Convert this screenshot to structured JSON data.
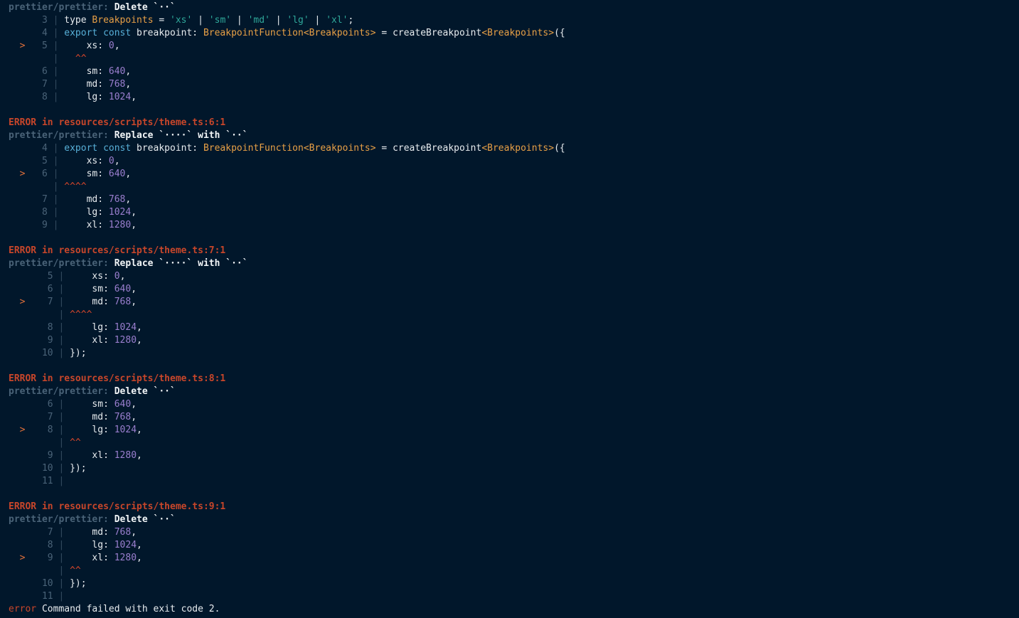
{
  "lines": [
    {
      "kind": "pp",
      "prefix": "prettier/prettier:",
      "msg": "Delete `··`"
    },
    {
      "kind": "code",
      "num": "3",
      "marked": false,
      "tokens": [
        {
          "c": "id",
          "t": "type "
        },
        {
          "c": "type",
          "t": "Breakpoints"
        },
        {
          "c": "id",
          "t": " = "
        },
        {
          "c": "str",
          "t": "'xs'"
        },
        {
          "c": "id",
          "t": " | "
        },
        {
          "c": "str",
          "t": "'sm'"
        },
        {
          "c": "id",
          "t": " | "
        },
        {
          "c": "str",
          "t": "'md'"
        },
        {
          "c": "id",
          "t": " | "
        },
        {
          "c": "str",
          "t": "'lg'"
        },
        {
          "c": "id",
          "t": " | "
        },
        {
          "c": "str",
          "t": "'xl'"
        },
        {
          "c": "id",
          "t": ";"
        }
      ]
    },
    {
      "kind": "code",
      "num": "4",
      "marked": false,
      "tokens": [
        {
          "c": "kw",
          "t": "export const "
        },
        {
          "c": "id",
          "t": "breakpoint: "
        },
        {
          "c": "type",
          "t": "BreakpointFunction<Breakpoints>"
        },
        {
          "c": "id",
          "t": " = createBreakpoint"
        },
        {
          "c": "type",
          "t": "<Breakpoints>"
        },
        {
          "c": "id",
          "t": "({"
        }
      ]
    },
    {
      "kind": "code",
      "num": "5",
      "marked": true,
      "tokens": [
        {
          "c": "id",
          "t": "    xs: "
        },
        {
          "c": "num",
          "t": "0"
        },
        {
          "c": "id",
          "t": ","
        }
      ]
    },
    {
      "kind": "caret",
      "caret": "  ^^"
    },
    {
      "kind": "code",
      "num": "6",
      "marked": false,
      "tokens": [
        {
          "c": "id",
          "t": "    sm: "
        },
        {
          "c": "num",
          "t": "640"
        },
        {
          "c": "id",
          "t": ","
        }
      ]
    },
    {
      "kind": "code",
      "num": "7",
      "marked": false,
      "tokens": [
        {
          "c": "id",
          "t": "    md: "
        },
        {
          "c": "num",
          "t": "768"
        },
        {
          "c": "id",
          "t": ","
        }
      ]
    },
    {
      "kind": "code",
      "num": "8",
      "marked": false,
      "tokens": [
        {
          "c": "id",
          "t": "    lg: "
        },
        {
          "c": "num",
          "t": "1024"
        },
        {
          "c": "id",
          "t": ","
        }
      ]
    },
    {
      "kind": "blank"
    },
    {
      "kind": "error",
      "label": "ERROR",
      "word": "in",
      "path": "resources/scripts/theme.ts:6:1"
    },
    {
      "kind": "pp",
      "prefix": "prettier/prettier:",
      "msg": "Replace `····` with `··`"
    },
    {
      "kind": "code",
      "num": "4",
      "marked": false,
      "tokens": [
        {
          "c": "kw",
          "t": "export const "
        },
        {
          "c": "id",
          "t": "breakpoint: "
        },
        {
          "c": "type",
          "t": "BreakpointFunction<Breakpoints>"
        },
        {
          "c": "id",
          "t": " = createBreakpoint"
        },
        {
          "c": "type",
          "t": "<Breakpoints>"
        },
        {
          "c": "id",
          "t": "({"
        }
      ]
    },
    {
      "kind": "code",
      "num": "5",
      "marked": false,
      "tokens": [
        {
          "c": "id",
          "t": "    xs: "
        },
        {
          "c": "num",
          "t": "0"
        },
        {
          "c": "id",
          "t": ","
        }
      ]
    },
    {
      "kind": "code",
      "num": "6",
      "marked": true,
      "tokens": [
        {
          "c": "id",
          "t": "    sm: "
        },
        {
          "c": "num",
          "t": "640"
        },
        {
          "c": "id",
          "t": ","
        }
      ]
    },
    {
      "kind": "caret",
      "caret": "^^^^"
    },
    {
      "kind": "code",
      "num": "7",
      "marked": false,
      "tokens": [
        {
          "c": "id",
          "t": "    md: "
        },
        {
          "c": "num",
          "t": "768"
        },
        {
          "c": "id",
          "t": ","
        }
      ]
    },
    {
      "kind": "code",
      "num": "8",
      "marked": false,
      "tokens": [
        {
          "c": "id",
          "t": "    lg: "
        },
        {
          "c": "num",
          "t": "1024"
        },
        {
          "c": "id",
          "t": ","
        }
      ]
    },
    {
      "kind": "code",
      "num": "9",
      "marked": false,
      "tokens": [
        {
          "c": "id",
          "t": "    xl: "
        },
        {
          "c": "num",
          "t": "1280"
        },
        {
          "c": "id",
          "t": ","
        }
      ]
    },
    {
      "kind": "blank"
    },
    {
      "kind": "error",
      "label": "ERROR",
      "word": "in",
      "path": "resources/scripts/theme.ts:7:1"
    },
    {
      "kind": "pp",
      "prefix": "prettier/prettier:",
      "msg": "Replace `····` with `··`"
    },
    {
      "kind": "code",
      "num": "5",
      "wide": true,
      "marked": false,
      "tokens": [
        {
          "c": "id",
          "t": "    xs: "
        },
        {
          "c": "num",
          "t": "0"
        },
        {
          "c": "id",
          "t": ","
        }
      ]
    },
    {
      "kind": "code",
      "num": "6",
      "wide": true,
      "marked": false,
      "tokens": [
        {
          "c": "id",
          "t": "    sm: "
        },
        {
          "c": "num",
          "t": "640"
        },
        {
          "c": "id",
          "t": ","
        }
      ]
    },
    {
      "kind": "code",
      "num": "7",
      "wide": true,
      "marked": true,
      "tokens": [
        {
          "c": "id",
          "t": "    md: "
        },
        {
          "c": "num",
          "t": "768"
        },
        {
          "c": "id",
          "t": ","
        }
      ]
    },
    {
      "kind": "caret",
      "wide": true,
      "caret": "^^^^"
    },
    {
      "kind": "code",
      "num": "8",
      "wide": true,
      "marked": false,
      "tokens": [
        {
          "c": "id",
          "t": "    lg: "
        },
        {
          "c": "num",
          "t": "1024"
        },
        {
          "c": "id",
          "t": ","
        }
      ]
    },
    {
      "kind": "code",
      "num": "9",
      "wide": true,
      "marked": false,
      "tokens": [
        {
          "c": "id",
          "t": "    xl: "
        },
        {
          "c": "num",
          "t": "1280"
        },
        {
          "c": "id",
          "t": ","
        }
      ]
    },
    {
      "kind": "code",
      "num": "10",
      "wide": true,
      "marked": false,
      "tokens": [
        {
          "c": "id",
          "t": "});"
        }
      ]
    },
    {
      "kind": "blank"
    },
    {
      "kind": "error",
      "label": "ERROR",
      "word": "in",
      "path": "resources/scripts/theme.ts:8:1"
    },
    {
      "kind": "pp",
      "prefix": "prettier/prettier:",
      "msg": "Delete `··`"
    },
    {
      "kind": "code",
      "num": "6",
      "wide": true,
      "marked": false,
      "tokens": [
        {
          "c": "id",
          "t": "    sm: "
        },
        {
          "c": "num",
          "t": "640"
        },
        {
          "c": "id",
          "t": ","
        }
      ]
    },
    {
      "kind": "code",
      "num": "7",
      "wide": true,
      "marked": false,
      "tokens": [
        {
          "c": "id",
          "t": "    md: "
        },
        {
          "c": "num",
          "t": "768"
        },
        {
          "c": "id",
          "t": ","
        }
      ]
    },
    {
      "kind": "code",
      "num": "8",
      "wide": true,
      "marked": true,
      "tokens": [
        {
          "c": "id",
          "t": "    lg: "
        },
        {
          "c": "num",
          "t": "1024"
        },
        {
          "c": "id",
          "t": ","
        }
      ]
    },
    {
      "kind": "caret",
      "wide": true,
      "caret": "^^"
    },
    {
      "kind": "code",
      "num": "9",
      "wide": true,
      "marked": false,
      "tokens": [
        {
          "c": "id",
          "t": "    xl: "
        },
        {
          "c": "num",
          "t": "1280"
        },
        {
          "c": "id",
          "t": ","
        }
      ]
    },
    {
      "kind": "code",
      "num": "10",
      "wide": true,
      "marked": false,
      "tokens": [
        {
          "c": "id",
          "t": "});"
        }
      ]
    },
    {
      "kind": "code",
      "num": "11",
      "wide": true,
      "marked": false,
      "tokens": []
    },
    {
      "kind": "blank"
    },
    {
      "kind": "error",
      "label": "ERROR",
      "word": "in",
      "path": "resources/scripts/theme.ts:9:1"
    },
    {
      "kind": "pp",
      "prefix": "prettier/prettier:",
      "msg": "Delete `··`"
    },
    {
      "kind": "code",
      "num": "7",
      "wide": true,
      "marked": false,
      "tokens": [
        {
          "c": "id",
          "t": "    md: "
        },
        {
          "c": "num",
          "t": "768"
        },
        {
          "c": "id",
          "t": ","
        }
      ]
    },
    {
      "kind": "code",
      "num": "8",
      "wide": true,
      "marked": false,
      "tokens": [
        {
          "c": "id",
          "t": "    lg: "
        },
        {
          "c": "num",
          "t": "1024"
        },
        {
          "c": "id",
          "t": ","
        }
      ]
    },
    {
      "kind": "code",
      "num": "9",
      "wide": true,
      "marked": true,
      "tokens": [
        {
          "c": "id",
          "t": "    xl: "
        },
        {
          "c": "num",
          "t": "1280"
        },
        {
          "c": "id",
          "t": ","
        }
      ]
    },
    {
      "kind": "caret",
      "wide": true,
      "caret": "^^"
    },
    {
      "kind": "code",
      "num": "10",
      "wide": true,
      "marked": false,
      "tokens": [
        {
          "c": "id",
          "t": "});"
        }
      ]
    },
    {
      "kind": "code",
      "num": "11",
      "wide": true,
      "marked": false,
      "tokens": []
    },
    {
      "kind": "final",
      "word": "error",
      "msg": "Command failed with exit code 2."
    }
  ]
}
